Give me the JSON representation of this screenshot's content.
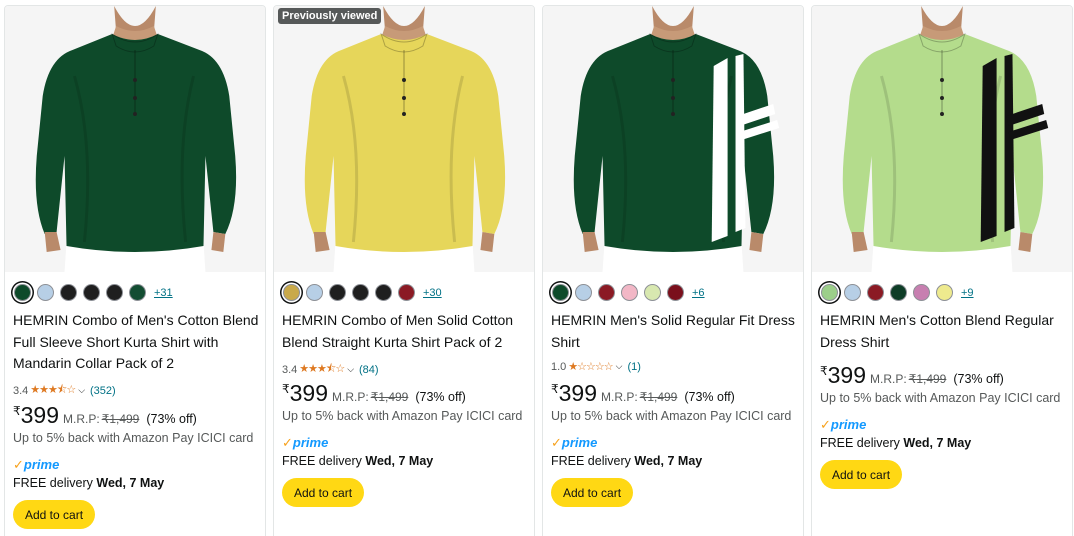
{
  "products": [
    {
      "badge": "",
      "shirt_color": "#0e4a2a",
      "stripe_color": "",
      "swatches": [
        "#0e4a2a",
        "#b7cfe6",
        "#1f1f1f",
        "#1f1f1f",
        "#1f1f1f",
        "#134d32"
      ],
      "more_colors": "+31",
      "title": "HEMRIN Combo of Men's Cotton Blend Full Sleeve Short Kurta Shirt with Mandarin Collar Pack of 2",
      "rating": "3.4",
      "stars": 3.5,
      "reviews": "(352)",
      "currency": "₹",
      "price": "399",
      "mrp_label": "M.R.P:",
      "mrp": "₹1,499",
      "discount": "(73% off)",
      "cashback": "Up to 5% back with Amazon Pay ICICI card",
      "prime": "prime",
      "delivery_prefix": "FREE delivery",
      "delivery_date": "Wed, 7 May",
      "button": "Add to cart"
    },
    {
      "badge": "Previously viewed",
      "shirt_color": "#e6d65a",
      "stripe_color": "",
      "swatches": [
        "#c9a94a",
        "#b7cfe6",
        "#1f1f1f",
        "#1f1f1f",
        "#1f1f1f",
        "#8b1a24"
      ],
      "more_colors": "+30",
      "title": "HEMRIN Combo of Men Solid Cotton Blend Straight Kurta Shirt Pack of 2",
      "rating": "3.4",
      "stars": 3.5,
      "reviews": "(84)",
      "currency": "₹",
      "price": "399",
      "mrp_label": "M.R.P:",
      "mrp": "₹1,499",
      "discount": "(73% off)",
      "cashback": "Up to 5% back with Amazon Pay ICICI card",
      "prime": "prime",
      "delivery_prefix": "FREE delivery",
      "delivery_date": "Wed, 7 May",
      "button": "Add to cart"
    },
    {
      "badge": "",
      "shirt_color": "#0e4a2a",
      "stripe_color": "#ffffff",
      "swatches": [
        "#0e4a2a",
        "#b7cfe6",
        "#8b1a24",
        "#f2b7c6",
        "#d8e8b0",
        "#7a0f1c"
      ],
      "more_colors": "+6",
      "title": "HEMRIN Men's Solid Regular Fit Dress Shirt",
      "rating": "1.0",
      "stars": 1,
      "reviews": "(1)",
      "currency": "₹",
      "price": "399",
      "mrp_label": "M.R.P:",
      "mrp": "₹1,499",
      "discount": "(73% off)",
      "cashback": "Up to 5% back with Amazon Pay ICICI card",
      "prime": "prime",
      "delivery_prefix": "FREE delivery",
      "delivery_date": "Wed, 7 May",
      "button": "Add to cart"
    },
    {
      "badge": "",
      "shirt_color": "#b4dc8c",
      "stripe_color": "#111111",
      "swatches": [
        "#9ccf8a",
        "#b7cfe6",
        "#8b1a24",
        "#0e3d27",
        "#c77fb0",
        "#eeea8e"
      ],
      "more_colors": "+9",
      "title": "HEMRIN Men's Cotton Blend Regular Dress Shirt",
      "rating": "",
      "stars": 0,
      "reviews": "",
      "currency": "₹",
      "price": "399",
      "mrp_label": "M.R.P:",
      "mrp": "₹1,499",
      "discount": "(73% off)",
      "cashback": "Up to 5% back with Amazon Pay ICICI card",
      "prime": "prime",
      "delivery_prefix": "FREE delivery",
      "delivery_date": "Wed, 7 May",
      "button": "Add to cart"
    }
  ]
}
